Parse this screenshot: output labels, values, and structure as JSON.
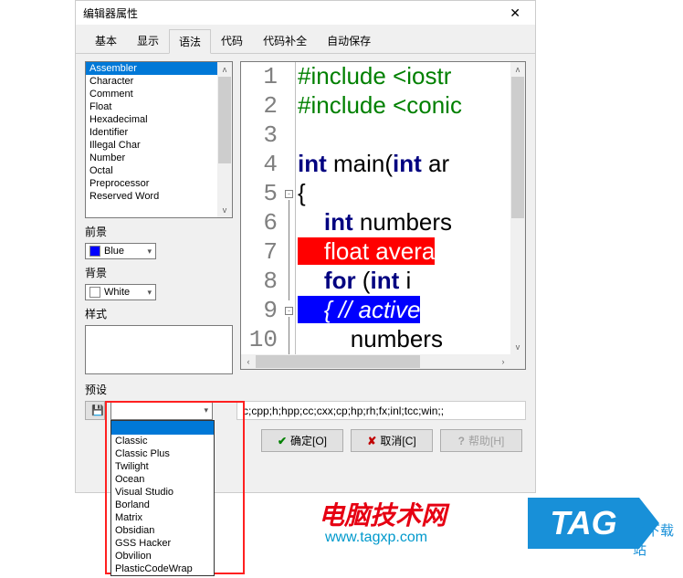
{
  "dialog": {
    "title": "编辑器属性",
    "tabs": [
      "基本",
      "显示",
      "语法",
      "代码",
      "代码补全",
      "自动保存"
    ],
    "active_tab": 2
  },
  "tokens": {
    "items": [
      "Assembler",
      "Character",
      "Comment",
      "Float",
      "Hexadecimal",
      "Identifier",
      "Illegal Char",
      "Number",
      "Octal",
      "Preprocessor",
      "Reserved Word"
    ],
    "selected": 0
  },
  "fg": {
    "label": "前景",
    "value": "Blue",
    "color": "#0000ff"
  },
  "bg": {
    "label": "背景",
    "value": "White",
    "color": "#ffffff"
  },
  "style": {
    "label": "样式"
  },
  "preview": {
    "lines": [
      {
        "n": "1",
        "segs": [
          {
            "t": "#include <iostr",
            "c": "green"
          }
        ]
      },
      {
        "n": "2",
        "segs": [
          {
            "t": "#include <conic",
            "c": "green"
          }
        ]
      },
      {
        "n": "3",
        "segs": []
      },
      {
        "n": "4",
        "segs": [
          {
            "t": "int",
            "c": "navy"
          },
          {
            "t": " main(",
            "c": "black"
          },
          {
            "t": "int",
            "c": "navy"
          },
          {
            "t": " ar",
            "c": "black"
          }
        ]
      },
      {
        "n": "5",
        "segs": [
          {
            "t": "{",
            "c": "black"
          }
        ]
      },
      {
        "n": "6",
        "segs": [
          {
            "t": "    ",
            "c": "black"
          },
          {
            "t": "int",
            "c": "navy"
          },
          {
            "t": " numbers",
            "c": "black"
          }
        ]
      },
      {
        "n": "7",
        "segs": [
          {
            "t": "    ",
            "c": "hl-red"
          },
          {
            "t": "float",
            "c": "hl-red"
          },
          {
            "t": " avera",
            "c": "hl-red"
          }
        ]
      },
      {
        "n": "8",
        "segs": [
          {
            "t": "    ",
            "c": "black"
          },
          {
            "t": "for",
            "c": "navy"
          },
          {
            "t": " (",
            "c": "black"
          },
          {
            "t": "int",
            "c": "navy"
          },
          {
            "t": " i ",
            "c": "black"
          }
        ]
      },
      {
        "n": "9",
        "segs": [
          {
            "t": "    { ",
            "c": "hl-blue"
          },
          {
            "t": "// active",
            "c": "hl-blue italic"
          }
        ]
      },
      {
        "n": "10",
        "segs": [
          {
            "t": "        numbers",
            "c": "black"
          }
        ]
      }
    ]
  },
  "preset": {
    "label": "预设",
    "selected": "",
    "options": [
      "Classic",
      "Classic Plus",
      "Twilight",
      "Ocean",
      "Visual Studio",
      "Borland",
      "Matrix",
      "Obsidian",
      "GSS Hacker",
      "Obvilion",
      "PlasticCodeWrap"
    ]
  },
  "extensions": "c;cpp;h;hpp;cc;cxx;cp;hp;rh;fx;inl;tcc;win;;",
  "buttons": {
    "ok": "确定[O]",
    "cancel": "取消[C]",
    "help": "帮助[H]"
  },
  "brand": {
    "name": "电脑技术网",
    "url": "www.tagxp.com",
    "tag": "TAG",
    "xz": "光下载站"
  }
}
